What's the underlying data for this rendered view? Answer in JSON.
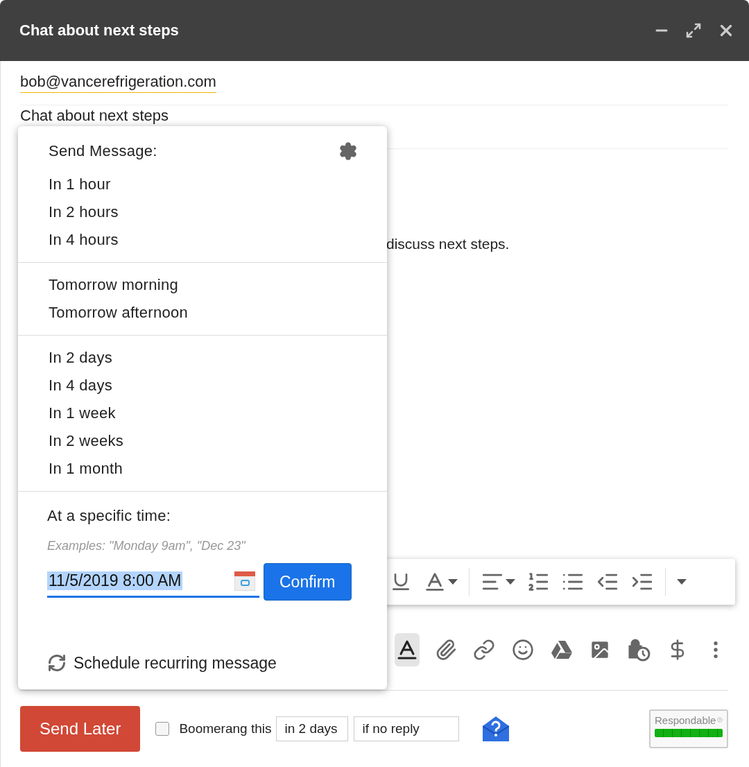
{
  "window": {
    "title": "Chat about next steps"
  },
  "recipient": "bob@vancerefrigeration.com",
  "subject": "Chat about next steps",
  "body": "discuss next steps.",
  "format_options_active": true,
  "schedule_menu": {
    "title": "Send Message:",
    "groups": [
      [
        "In 1 hour",
        "In 2 hours",
        "In 4 hours"
      ],
      [
        "Tomorrow morning",
        "Tomorrow afternoon"
      ],
      [
        "In 2 days",
        "In 4 days",
        "In 1 week",
        "In 2 weeks",
        "In 1 month"
      ]
    ],
    "specific_time": {
      "label": "At a specific time:",
      "examples": "Examples: \"Monday 9am\", \"Dec 23\"",
      "value": "11/5/2019 8:00 AM",
      "confirm": "Confirm"
    },
    "recurring": "Schedule recurring message"
  },
  "footer": {
    "send": "Send Later",
    "boomerang": {
      "checked": false,
      "label": "Boomerang this",
      "delay": "in 2 days",
      "condition": "if no reply"
    },
    "respondable": {
      "label": "Respondable",
      "level": 1
    }
  }
}
